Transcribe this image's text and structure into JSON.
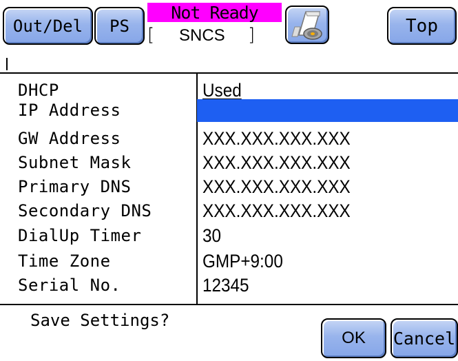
{
  "header": {
    "out_del_label": "Out/Del",
    "ps_label": "PS",
    "status_text": "Not Ready",
    "status_color": "#ff00ff",
    "mode_bracket_left": "[",
    "mode_text": "SNCS",
    "mode_bracket_right": "]",
    "printer_icon": "paper-roll-icon",
    "top_label": "Top"
  },
  "settings": [
    {
      "label": "DHCP",
      "value": "Used"
    },
    {
      "label": "IP Address",
      "value": ""
    },
    {
      "label": "GW Address",
      "value": "XXX.XXX.XXX.XXX"
    },
    {
      "label": "Subnet Mask",
      "value": "XXX.XXX.XXX.XXX"
    },
    {
      "label": "Primary DNS",
      "value": "XXX.XXX.XXX.XXX"
    },
    {
      "label": "Secondary DNS",
      "value": "XXX.XXX.XXX.XXX"
    },
    {
      "label": "DialUp Timer",
      "value": "30"
    },
    {
      "label": "Time Zone",
      "value": "GMP+9:00"
    },
    {
      "label": "Serial No.",
      "value": "12345"
    }
  ],
  "selection_color": "#1e5ff2",
  "footer": {
    "prompt": "Save Settings?",
    "ok_label": "OK",
    "cancel_label": "Cancel"
  }
}
